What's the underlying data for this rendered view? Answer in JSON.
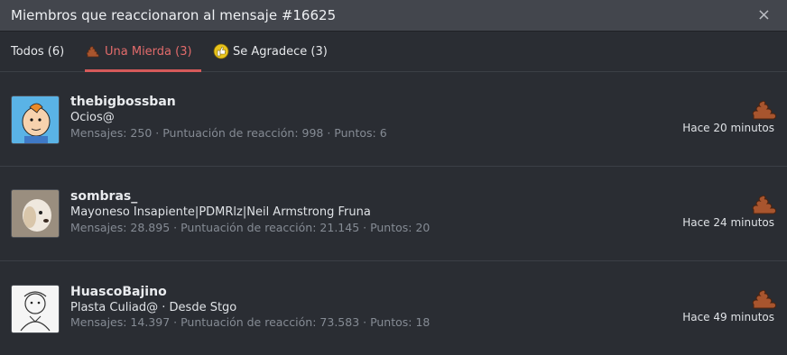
{
  "header": {
    "title": "Miembros que reaccionaron al mensaje #16625",
    "close": "×"
  },
  "tabs": [
    {
      "label": "Todos (6)"
    },
    {
      "label": "Una Mierda (3)"
    },
    {
      "label": "Se Agradece (3)"
    }
  ],
  "members": [
    {
      "name": "thebigbossban",
      "subtitle": "Ocios@",
      "stats": "Mensajes: 250 · Puntuación de reacción: 998 · Puntos: 6",
      "time": "Hace 20 minutos"
    },
    {
      "name": "sombras_",
      "subtitle": "Mayoneso Insapiente|PDMRlz|Neil Armstrong Fruna",
      "stats": "Mensajes: 28.895 · Puntuación de reacción: 21.145 · Puntos: 20",
      "time": "Hace 24 minutos"
    },
    {
      "name": "HuascoBajino",
      "subtitle": "Plasta Culiad@ · Desde Stgo",
      "stats": "Mensajes: 14.397 · Puntuación de reacción: 73.583 · Puntos: 18",
      "time": "Hace 49 minutos"
    }
  ],
  "colors": {
    "accent": "#d65a5a",
    "header_bg": "#43464d",
    "bg": "#2a2d33"
  },
  "icons": {
    "reaction": "poop-icon",
    "thanks": "thumbs-up-icon"
  }
}
